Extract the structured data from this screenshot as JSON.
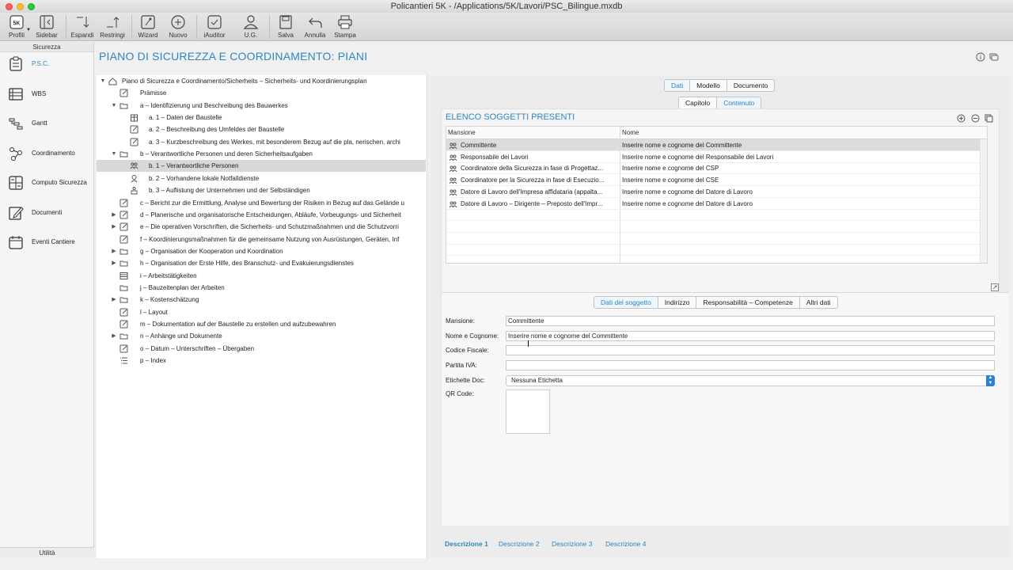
{
  "window": {
    "title": "Policantieri 5K - /Applications/5K/Lavori/PSC_Bilingue.mxdb"
  },
  "toolbar": {
    "profili": "Profili",
    "sidebar": "Sidebar",
    "espandi": "Espandi",
    "restringi": "Restringi",
    "wizard": "Wizard",
    "nuovo": "Nuovo",
    "iauditor": "iAuditor",
    "ug": "U.G.",
    "salva": "Salva",
    "annulla": "Annulla",
    "stampa": "Stampa",
    "logo_text": "5K"
  },
  "sidebar": {
    "header": "Sicurezza",
    "footer": "Utilità",
    "items": [
      {
        "label": "P.S.C.",
        "icon": "clipboard-icon",
        "active": true
      },
      {
        "label": "WBS",
        "icon": "list-icon"
      },
      {
        "label": "Gantt",
        "icon": "gantt-icon"
      },
      {
        "label": "Coordinamento",
        "icon": "network-icon"
      },
      {
        "label": "Computo Sicurezza",
        "icon": "calculator-icon"
      },
      {
        "label": "Documenti",
        "icon": "edit-document-icon"
      },
      {
        "label": "Eventi Cantiere",
        "icon": "calendar-icon"
      }
    ]
  },
  "page": {
    "title": "PIANO DI SICUREZZA E COORDINAMENTO: PIANI"
  },
  "tree": {
    "rows": [
      {
        "text": "Piano di Sicurezza e Coordinamento/Sicherheits – Sicherheits- und Koordinierungsplan",
        "level": 0,
        "disc": "open",
        "icon": "home-icon"
      },
      {
        "text": "Prämisse",
        "level": 1,
        "disc": "",
        "icon": "edit-icon"
      },
      {
        "text": "a – Identifizierung und Beschreibung des Bauwerkes",
        "level": 1,
        "disc": "open",
        "icon": "folder-icon"
      },
      {
        "text": "a.  1 – Daten der Baustelle",
        "level": 2,
        "disc": "",
        "icon": "building-icon"
      },
      {
        "text": "a.  2 – Beschreibung des Umfeldes der Baustelle",
        "level": 2,
        "disc": "",
        "icon": "edit-icon"
      },
      {
        "text": "a.  3 – Kurzbeschreibung des Werkes, mit besonderem Bezug auf die pla, nerischen, archi",
        "level": 2,
        "disc": "",
        "icon": "edit-icon"
      },
      {
        "text": "b – Verantwortliche Personen und deren Sicherheitsaufgaben",
        "level": 1,
        "disc": "open",
        "icon": "folder-icon"
      },
      {
        "text": "b.  1 – Verantwortliche Personen",
        "level": 2,
        "disc": "",
        "icon": "people-icon",
        "selected": true
      },
      {
        "text": "b.  2 – Vorhandene lokale Notfalldienste",
        "level": 2,
        "disc": "",
        "icon": "person-icon"
      },
      {
        "text": "b.  3 – Auflistung der Unternehmen und der Selbständigen",
        "level": 2,
        "disc": "",
        "icon": "company-icon"
      },
      {
        "text": "c – Bericht zur die Ermittlung, Analyse und Bewertung der Risiken in Bezug auf das Gelände u",
        "level": 1,
        "disc": "",
        "icon": "edit-icon"
      },
      {
        "text": "d – Planerische und organisatorische Entscheidungen, Abläufe, Vorbeugungs- und Sicherheit",
        "level": 1,
        "disc": "closed",
        "icon": "edit-icon"
      },
      {
        "text": "e – Die operativen Vorschriften, die Sicherheits- und Schutzmaßnahmen und die Schutzvorri",
        "level": 1,
        "disc": "closed",
        "icon": "edit-icon"
      },
      {
        "text": "f – Koordinierungsmaßnahmen für die gemeinsame Nutzung von Ausrüstungen, Geräten, Inf",
        "level": 1,
        "disc": "",
        "icon": "edit-icon"
      },
      {
        "text": "g – Organisation der Kooperation und Koordination",
        "level": 1,
        "disc": "closed",
        "icon": "folder-icon"
      },
      {
        "text": "h – Organisation der Erste Hilfe, des Branschutz- und Evakuierungsdienstes",
        "level": 1,
        "disc": "closed",
        "icon": "folder-icon"
      },
      {
        "text": "i – Arbeitstätigkeiten",
        "level": 1,
        "disc": "",
        "icon": "list-icon"
      },
      {
        "text": "j – Bauzeitenplan der Arbeiten",
        "level": 1,
        "disc": "",
        "icon": "folder-icon"
      },
      {
        "text": "k – Kostenschätzung",
        "level": 1,
        "disc": "closed",
        "icon": "folder-icon"
      },
      {
        "text": "l – Layout",
        "level": 1,
        "disc": "",
        "icon": "edit-icon"
      },
      {
        "text": "m – Dokumentation auf der Baustelle zu erstellen und aufzubewahren",
        "level": 1,
        "disc": "",
        "icon": "edit-icon"
      },
      {
        "text": "n – Anhänge und Dokumente",
        "level": 1,
        "disc": "closed",
        "icon": "folder-icon"
      },
      {
        "text": "o – Datum – Unterschriften – Übergaben",
        "level": 1,
        "disc": "",
        "icon": "edit-icon"
      },
      {
        "text": "p – Index",
        "level": 1,
        "disc": "",
        "icon": "index-icon"
      }
    ]
  },
  "right": {
    "tabs_top": [
      "Dati",
      "Modello",
      "Documento"
    ],
    "tabs_sub": [
      "Capitolo",
      "Contenuto"
    ],
    "section_title": "ELENCO SOGGETTI PRESENTI",
    "table": {
      "headers": [
        "Mansione",
        "Nome"
      ],
      "rows": [
        [
          "Committente",
          "Inserire nome e cognome del Committente"
        ],
        [
          "Responsabile dei Lavori",
          "Inserire nome e cognome del Responsabile dei Lavori"
        ],
        [
          "Coordinatore della Sicurezza in fase di Progettaz...",
          "Inserire nome e cognome del CSP"
        ],
        [
          "Coordinatore per la Sicurezza in fase di Esecuzio...",
          "Inserire nome e cognome del CSE"
        ],
        [
          "Datore di Lavoro dell'Impresa affidataria (appalta...",
          "Inserire nome e cognome del Datore di Lavoro"
        ],
        [
          "Datore di Lavoro – Dirigente – Preposto dell'Impr...",
          "Inserire nome e cognome del Datore di Lavoro"
        ]
      ]
    },
    "form_tabs": [
      "Dati del soggetto",
      "Indirizzo",
      "Responsabilità – Competenze",
      "Altri dati"
    ],
    "form": {
      "mansione_label": "Mansione:",
      "mansione_value": "Committente",
      "nome_label": "Nome e Cognome:",
      "nome_value": "Inserire nome e cognome del Committente",
      "cf_label": "Codice Fiscale:",
      "cf_value": "",
      "piva_label": "Partita IVA:",
      "piva_value": "",
      "etichette_label": "Etichette Doc:",
      "etichette_value": "Nessuna Etichetta",
      "qr_label": "QR Code:"
    },
    "desc_tabs": [
      "Descrizione 1",
      "Descrizione 2",
      "Descrizione 3",
      "Descrizione 4"
    ]
  },
  "colors": {
    "accent": "#2e86c1",
    "select_arrow": "#2e7fd6",
    "row_selected": "#d8d8d8"
  }
}
